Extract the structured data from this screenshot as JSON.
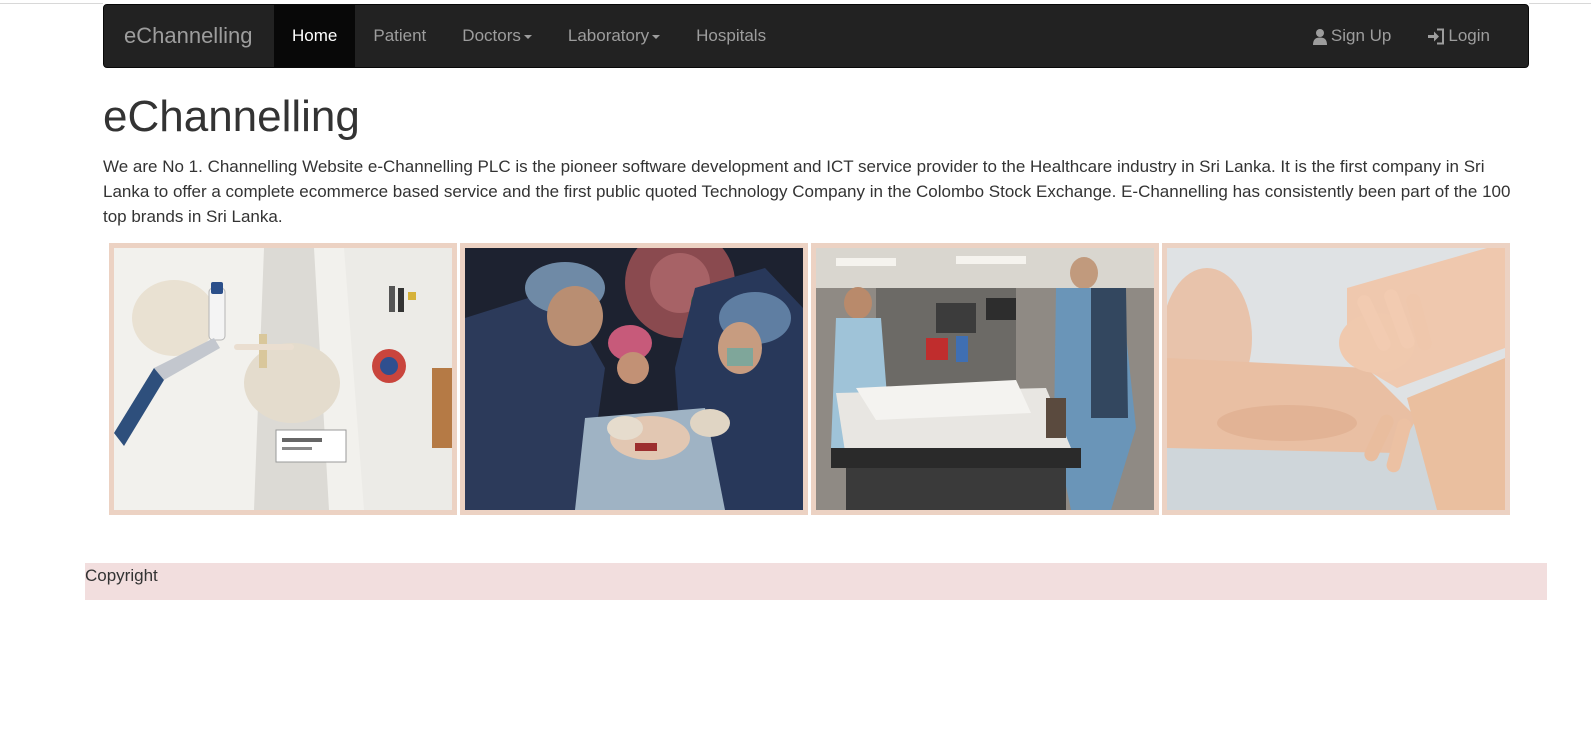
{
  "navbar": {
    "brand": "eChannelling",
    "items": [
      {
        "label": "Home",
        "active": true,
        "dropdown": false
      },
      {
        "label": "Patient",
        "active": false,
        "dropdown": false
      },
      {
        "label": "Doctors",
        "active": false,
        "dropdown": true
      },
      {
        "label": "Laboratory",
        "active": false,
        "dropdown": true
      },
      {
        "label": "Hospitals",
        "active": false,
        "dropdown": false
      }
    ],
    "right_items": [
      {
        "label": "Sign Up",
        "icon": "user-icon"
      },
      {
        "label": "Login",
        "icon": "log-in-icon"
      }
    ],
    "background_color": "#222222",
    "active_background_color": "#080808"
  },
  "main": {
    "title": "eChannelling",
    "intro": "We are No 1. Channelling Website e-Channelling PLC is the pioneer software development and ICT service provider to the Healthcare industry in Sri Lanka. It is the first company in Sri Lanka to offer a complete ecommerce based service and the first public quoted Technology Company in the Colombo Stock Exchange. E-Channelling has consistently been part of the 100 top brands in Sri Lanka."
  },
  "gallery": {
    "images": [
      {
        "name": "lab-coat-sample-image"
      },
      {
        "name": "surgery-team-image"
      },
      {
        "name": "emergency-room-image"
      },
      {
        "name": "hands-pulse-image"
      }
    ],
    "frame_color": "#ecd2c3"
  },
  "footer": {
    "text": "Copyright",
    "background_color": "#f2dede"
  }
}
